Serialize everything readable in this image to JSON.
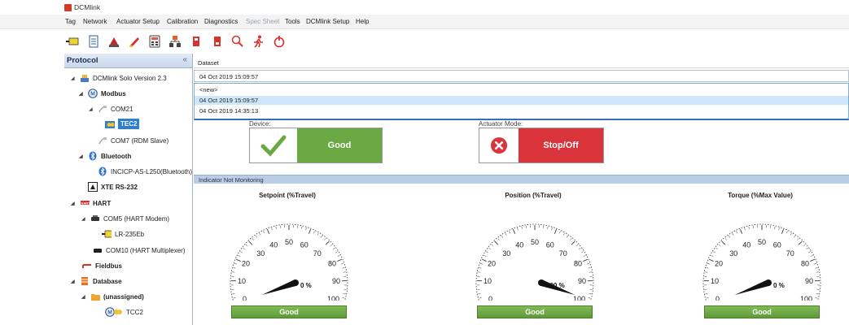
{
  "app": {
    "title": "DCMlink"
  },
  "menu": [
    "Tag",
    "Network",
    "Actuator Setup",
    "Calibration",
    "Diagnostics",
    "Spec Sheet",
    "Tools",
    "DCMlink Setup",
    "Help"
  ],
  "toolbar_icons": [
    "tag-icon",
    "document-icon",
    "actuator-icon",
    "pen-icon",
    "calculator-icon",
    "network-icon",
    "tag-red-icon",
    "tag-red-2-icon",
    "search-icon",
    "runner-icon",
    "power-icon"
  ],
  "left_panel": {
    "title": "Protocol",
    "collapse": "«",
    "tree": [
      {
        "label": "DCMlink Solo Version 2.3",
        "icon": "network-icon"
      },
      {
        "label": "Modbus",
        "icon": "modbus-icon"
      },
      {
        "label": "COM21",
        "icon": "port-icon"
      },
      {
        "label": "TEC2",
        "icon": "device-icon"
      },
      {
        "label": "COM7 (RDM Slave)",
        "icon": "port-icon"
      },
      {
        "label": "Bluetooth",
        "icon": "bluetooth-icon"
      },
      {
        "label": "INCICP-AS-L250(Bluetooth)",
        "icon": "bluetooth-icon"
      },
      {
        "label": "XTE RS-232",
        "icon": "rs232-icon"
      },
      {
        "label": "HART",
        "icon": "hart-icon"
      },
      {
        "label": "COM5 (HART Modem)",
        "icon": "modem-icon"
      },
      {
        "label": "LR-235Eb",
        "icon": "tag-icon"
      },
      {
        "label": "COM10 (HART Multiplexer)",
        "icon": "multiplexer-icon"
      },
      {
        "label": "Fieldbus",
        "icon": "fieldbus-icon"
      },
      {
        "label": "Database",
        "icon": "database-icon"
      },
      {
        "label": "(unassigned)",
        "icon": "folder-icon"
      },
      {
        "label": "TCC2",
        "icon": "modbus-device-icon"
      }
    ]
  },
  "dataset": {
    "label": "Dataset",
    "selected": "04 Oct 2019 15:09:57",
    "options": [
      "<new>",
      "04 Oct 2019 15:09:57",
      "04 Oct 2019 14:35:13"
    ]
  },
  "status": {
    "device_label": "Device:",
    "device_value": "Good",
    "mode_label": "Actuator Mode:",
    "mode_value": "Stop/Off",
    "colors": {
      "good": "#6aa843",
      "bad": "#d9333b"
    }
  },
  "indicator_bar": "Indicator Not Monitoring",
  "gauges": [
    {
      "title": "Setpoint (%Travel)",
      "value": 0,
      "readout": "0 %",
      "status": "Good"
    },
    {
      "title": "Position (%Travel)",
      "value": 100,
      "readout": "100 %",
      "status": "Good"
    },
    {
      "title": "Torque (%Max Value)",
      "value": 0,
      "readout": "0 %",
      "status": "Good"
    }
  ],
  "gauge_ticks": [
    "0",
    "10",
    "20",
    "30",
    "40",
    "50",
    "60",
    "70",
    "80",
    "90",
    "100"
  ]
}
